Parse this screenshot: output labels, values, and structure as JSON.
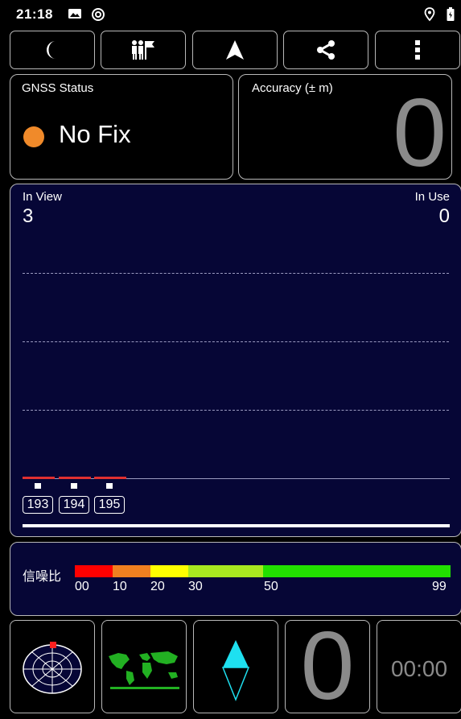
{
  "status_bar": {
    "time": "21:18",
    "icons": [
      "image-icon",
      "sync-icon",
      "location-icon",
      "battery-icon"
    ]
  },
  "toolbar": {
    "buttons": [
      "night-mode-icon",
      "tour-guide-icon",
      "navigation-arrow-icon",
      "share-icon",
      "more-menu-icon"
    ]
  },
  "gnss_status": {
    "label": "GNSS Status",
    "value": "No Fix",
    "indicator_color": "#f08a2a"
  },
  "accuracy": {
    "label": "Accuracy (± m)",
    "value": "0"
  },
  "satellites": {
    "in_view_label": "In View",
    "in_view_value": "3",
    "in_use_label": "In Use",
    "in_use_value": "0",
    "ids": [
      "193",
      "194",
      "195"
    ],
    "background_color": "#060636"
  },
  "snr": {
    "label": "信噪比",
    "ticks": [
      "00",
      "10",
      "20",
      "30",
      "50",
      "99"
    ],
    "colors": [
      "#ff0000",
      "#f08020",
      "#ffff00",
      "#a8e820",
      "#22e000"
    ]
  },
  "bottom_bar": {
    "buttons": [
      "radar-icon",
      "world-map-icon",
      "compass-icon"
    ],
    "big_value": "0",
    "timer": "00:00"
  }
}
